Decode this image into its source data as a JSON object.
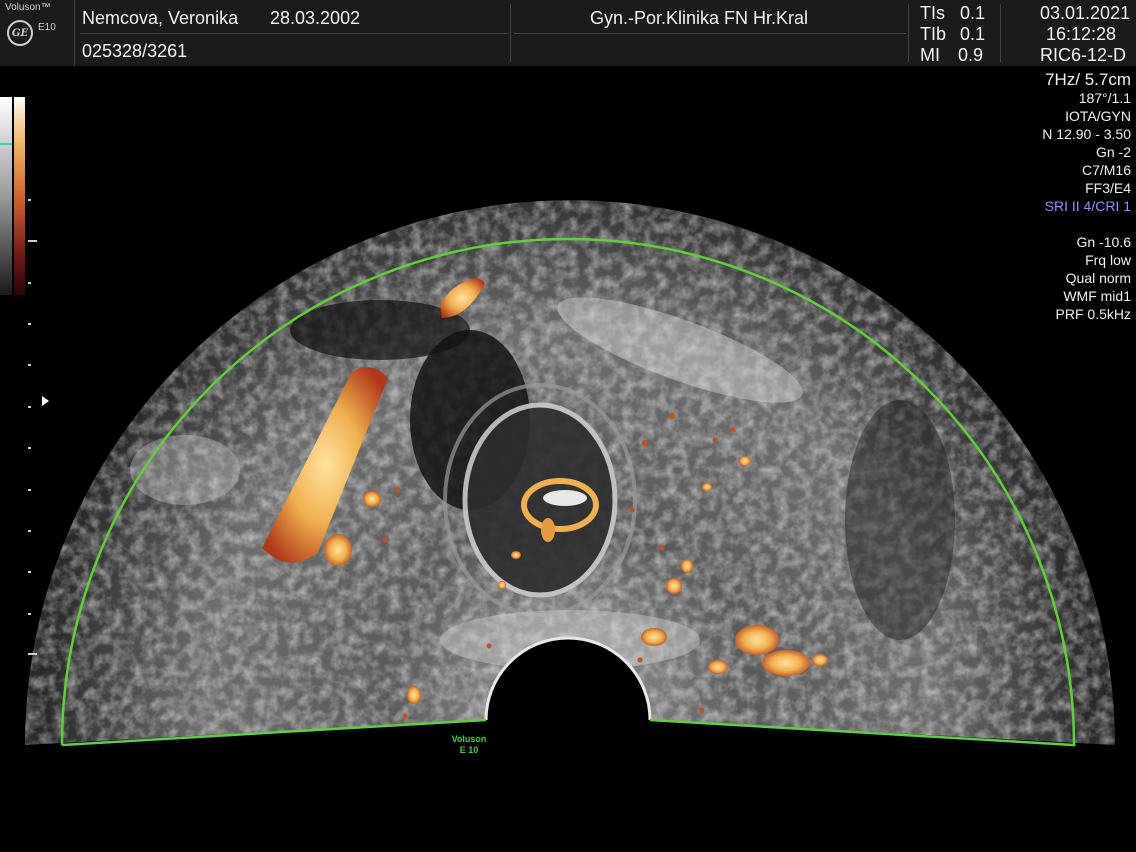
{
  "header": {
    "brand": "Voluson™",
    "model": "E10",
    "logo": "GE",
    "patient_name": "Nemcova, Veronika",
    "birth_date": "28.03.2002",
    "patient_id": "025328/3261",
    "clinic": "Gyn.-Por.Klinika FN Hr.Kral",
    "tis_label": "TIs",
    "tis_value": "0.1",
    "tib_label": "TIb",
    "tib_value": "0.1",
    "mi_label": "MI",
    "mi_value": "0.9",
    "date": "03.01.2021",
    "time": "16:12:28",
    "probe": "RIC6-12-D"
  },
  "params": {
    "freq_depth": "7Hz/ 5.7cm",
    "angle": "187°/1.1",
    "preset": "IOTA/GYN",
    "harmonic": "N 12.90 - 3.50",
    "gain": "Gn  -2",
    "c_m": "C7/M16",
    "ff_e": "FF3/E4",
    "sri": "SRI II 4/CRI 1"
  },
  "doppler": {
    "gain": "Gn -10.6",
    "freq": "Frq low",
    "quality": "Qual norm",
    "wmf": "WMF mid1",
    "prf": "PRF  0.5kHz"
  },
  "footer": {
    "mark_line1": "Voluson",
    "mark_line2": "E 10"
  },
  "colors": {
    "roi": "#5fcf3a",
    "doppler_hot": "#f0b050",
    "doppler_dark": "#b03818",
    "sri_text": "#8f8fff"
  },
  "icons": [
    "ge-logo-icon",
    "focus-marker-icon"
  ]
}
